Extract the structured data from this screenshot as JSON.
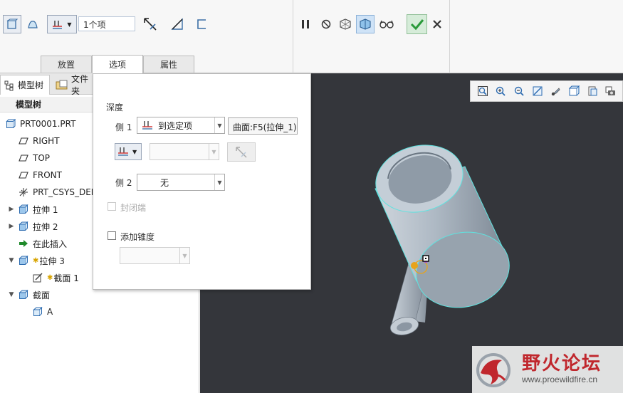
{
  "ribbon": {
    "selection_input_value": "1个项",
    "tabs": [
      {
        "label": "放置",
        "active": false
      },
      {
        "label": "选项",
        "active": true
      },
      {
        "label": "属性",
        "active": false
      }
    ]
  },
  "left_panel": {
    "tabs": [
      {
        "label": "模型树",
        "active": true
      },
      {
        "label": "文件夹",
        "active": false
      }
    ],
    "tree_header": "模型树",
    "tree": [
      {
        "label": "PRT0001.PRT",
        "icon": "part-icon",
        "level": 0,
        "expander": ""
      },
      {
        "label": "RIGHT",
        "icon": "datum-plane-icon",
        "level": 1,
        "expander": ""
      },
      {
        "label": "TOP",
        "icon": "datum-plane-icon",
        "level": 1,
        "expander": ""
      },
      {
        "label": "FRONT",
        "icon": "datum-plane-icon",
        "level": 1,
        "expander": ""
      },
      {
        "label": "PRT_CSYS_DEF",
        "icon": "csys-icon",
        "level": 1,
        "expander": ""
      },
      {
        "label": "拉伸 1",
        "icon": "extrude-icon",
        "level": 1,
        "expander": "collapsed"
      },
      {
        "label": "拉伸 2",
        "icon": "extrude-icon",
        "level": 1,
        "expander": "collapsed"
      },
      {
        "label": "在此插入",
        "icon": "insert-here-icon",
        "level": 1,
        "expander": ""
      },
      {
        "label": "拉伸 3",
        "icon": "extrude-icon",
        "level": 1,
        "expander": "expanded",
        "new": true
      },
      {
        "label": "截面 1",
        "icon": "sketch-icon",
        "level": 2,
        "expander": "",
        "new": true
      },
      {
        "label": "截面",
        "icon": "section-icon",
        "level": 1,
        "expander": "expanded"
      },
      {
        "label": "A",
        "icon": "section-item-icon",
        "level": 2,
        "expander": ""
      }
    ]
  },
  "options_panel": {
    "depth_label": "深度",
    "side1_label": "侧 1",
    "side1_value": "到选定项",
    "side1_reference": "曲面:F5(拉伸_1)",
    "side2_label": "侧 2",
    "side2_value": "无",
    "capped_ends_label": "封闭端",
    "add_taper_label": "添加锥度"
  },
  "watermark": {
    "title": "野火论坛",
    "url": "www.proewildfire.cn"
  },
  "colors": {
    "viewport_bg": "#34363b",
    "accent_check": "#2a9a3a",
    "highlight_edge": "#5fe3e0",
    "part_body": "#a8b4c0",
    "watermark_red": "#c0272d"
  }
}
